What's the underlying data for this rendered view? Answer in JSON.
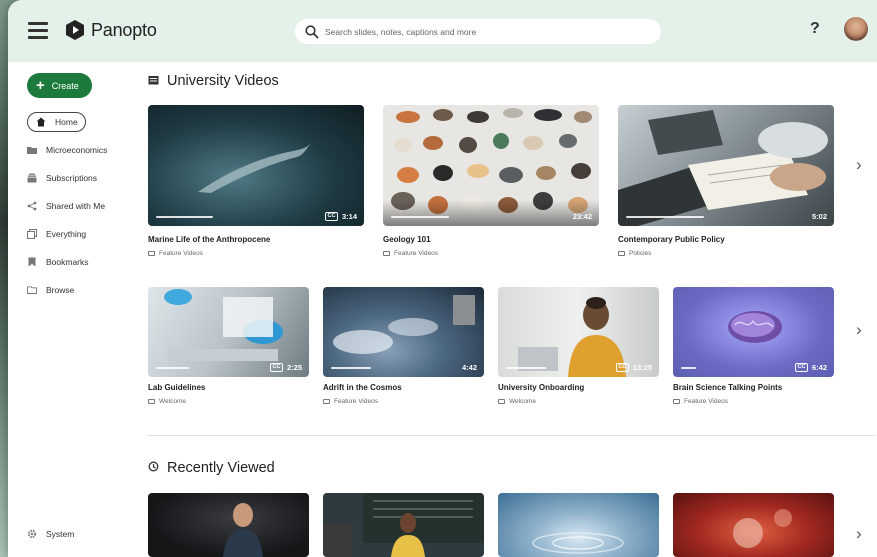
{
  "header": {
    "app_name": "Panopto",
    "search_placeholder": "Search slides, notes, captions and more",
    "help_label": "?"
  },
  "sidebar": {
    "create_label": "Create",
    "items": [
      {
        "label": "Home",
        "icon": "home-icon"
      },
      {
        "label": "Microeconomics",
        "icon": "folder-icon"
      },
      {
        "label": "Subscriptions",
        "icon": "subscriptions-icon"
      },
      {
        "label": "Shared with Me",
        "icon": "share-icon"
      },
      {
        "label": "Everything",
        "icon": "layers-icon"
      },
      {
        "label": "Bookmarks",
        "icon": "bookmark-icon"
      },
      {
        "label": "Browse",
        "icon": "folder-outline-icon"
      }
    ],
    "system_label": "System"
  },
  "sections": {
    "university_videos": {
      "title": "University Videos",
      "row1": [
        {
          "title": "Marine Life of the Anthropocene",
          "folder": "Feature Videos",
          "duration": "3:14",
          "cc": true,
          "progress": 0.4
        },
        {
          "title": "Geology 101",
          "folder": "Feature Videos",
          "duration": "23:42",
          "cc": false,
          "progress": 0.3
        },
        {
          "title": "Contemporary Public Policy",
          "folder": "Policies",
          "duration": "5:02",
          "cc": false,
          "progress": 0.45
        }
      ],
      "row2": [
        {
          "title": "Lab Guidelines",
          "folder": "Welcome",
          "duration": "2:25",
          "cc": true,
          "progress": 0.25
        },
        {
          "title": "Adrift in the Cosmos",
          "folder": "Feature Videos",
          "duration": "4:42",
          "cc": false,
          "progress": 0.3
        },
        {
          "title": "University Onboarding",
          "folder": "Welcome",
          "duration": "13:25",
          "cc": true,
          "progress": 0.3
        },
        {
          "title": "Brain Science Talking Points",
          "folder": "Feature Videos",
          "duration": "6:42",
          "cc": true,
          "progress": 0.12
        }
      ]
    },
    "recently_viewed": {
      "title": "Recently Viewed"
    }
  },
  "colors": {
    "topbar": "#e4f1e9",
    "create_button": "#1c7a3c"
  }
}
